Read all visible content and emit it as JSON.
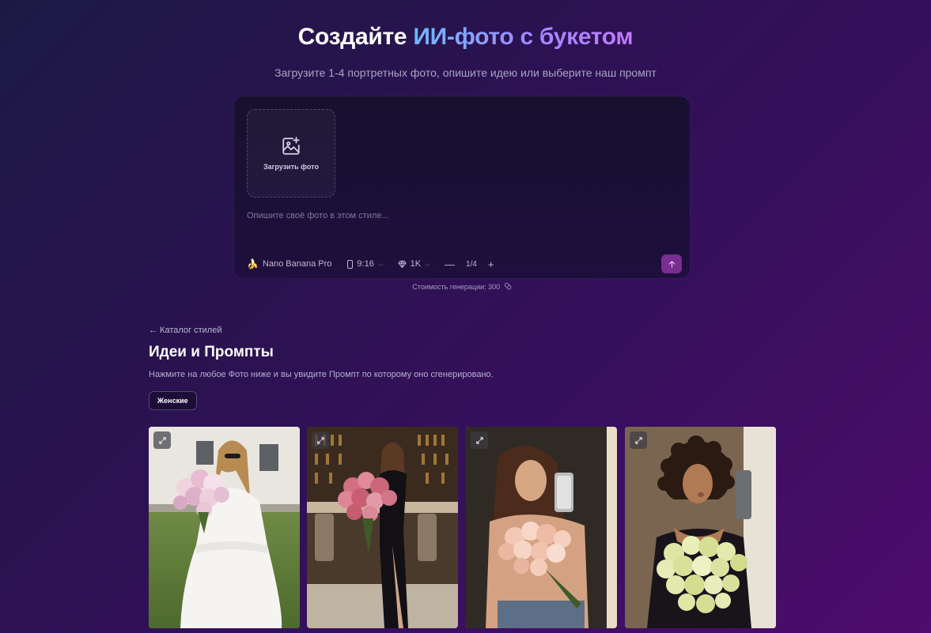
{
  "hero": {
    "title_plain": "Создайте ",
    "title_accent": "ИИ-фото с букетом",
    "subtitle": "Загрузите 1-4 портретных фото, опишите идею или выберите наш промпт"
  },
  "composer": {
    "upload_label": "Загрузить фото",
    "prompt_placeholder": "Опишите своё фото в этом стиле...",
    "model_label": "Nano Banana Pro",
    "model_icon": "banana-icon",
    "ratio_label": "9:16",
    "resolution_label": "1K",
    "count_label": "1/4",
    "minus_label": "—",
    "plus_label": "+",
    "send_color": "#7a2d92"
  },
  "cost_label": "Стоимость генерации: 300",
  "catalog": {
    "back_label": "← Каталог стилей",
    "title": "Идеи и Промпты",
    "description": "Нажмите на любое Фото ниже и вы увидите Промпт по которому оно сгенерировано.",
    "filter_chip": "Женские"
  },
  "gallery": {
    "count": 4
  }
}
